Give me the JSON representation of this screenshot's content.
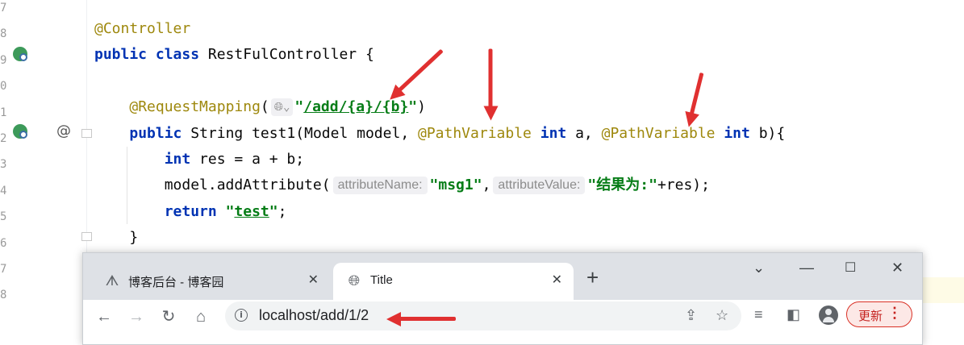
{
  "editor": {
    "line_numbers": [
      "7",
      "8",
      "9",
      "0",
      "1",
      "2",
      "3",
      "4",
      "5",
      "6",
      "7",
      "8"
    ],
    "lines": [
      [
        {
          "t": "@Controller",
          "c": "ann"
        }
      ],
      [
        {
          "t": "public class",
          "c": "kw"
        },
        {
          "t": " RestFulController {"
        }
      ],
      [],
      [
        {
          "t": "    "
        },
        {
          "t": "@RequestMapping",
          "c": "ann"
        },
        {
          "t": "("
        },
        {
          "globe": true
        },
        {
          "t": "\"",
          "c": "str"
        },
        {
          "t": "/add/{a}/{b}",
          "c": "url"
        },
        {
          "t": "\"",
          "c": "str"
        },
        {
          "t": ")"
        }
      ],
      [
        {
          "t": "    "
        },
        {
          "t": "public",
          "c": "kw"
        },
        {
          "t": " String test1(Model model, "
        },
        {
          "t": "@PathVariable",
          "c": "ann"
        },
        {
          "t": " "
        },
        {
          "t": "int",
          "c": "kw"
        },
        {
          "t": " a, "
        },
        {
          "t": "@PathVariable",
          "c": "ann"
        },
        {
          "t": " "
        },
        {
          "t": "int",
          "c": "kw"
        },
        {
          "t": " b){"
        }
      ],
      [
        {
          "t": "        "
        },
        {
          "t": "int",
          "c": "kw"
        },
        {
          "t": " res = a + b;"
        }
      ],
      [
        {
          "t": "        model.addAttribute("
        },
        {
          "hint": "attributeName:"
        },
        {
          "t": "\"msg1\"",
          "c": "str"
        },
        {
          "t": ","
        },
        {
          "hint": "attributeValue:"
        },
        {
          "t": "\"结果为:\"",
          "c": "str"
        },
        {
          "t": "+res);"
        }
      ],
      [
        {
          "t": "        "
        },
        {
          "t": "return",
          "c": "kw"
        },
        {
          "t": " "
        },
        {
          "t": "\"",
          "c": "str"
        },
        {
          "t": "test",
          "c": "url"
        },
        {
          "t": "\"",
          "c": "str"
        },
        {
          "t": ";"
        }
      ],
      [
        {
          "t": "    }"
        }
      ]
    ]
  },
  "browser": {
    "tabs": [
      {
        "label": "博客后台 - 博客园",
        "icon": "cnblogs-icon",
        "active": false
      },
      {
        "label": "Title",
        "icon": "globe-icon",
        "active": true
      }
    ],
    "new_tab": "+",
    "url": "localhost/add/1/2",
    "update_label": "更新",
    "window_controls": {
      "dropdown": "⌄",
      "minimize": "—",
      "maximize": "☐",
      "close": "✕"
    }
  },
  "colors": {
    "keyword": "#0033b3",
    "annotation": "#9e880d",
    "string": "#067d17",
    "arrow": "#e03030",
    "update_button": "#d93025"
  }
}
